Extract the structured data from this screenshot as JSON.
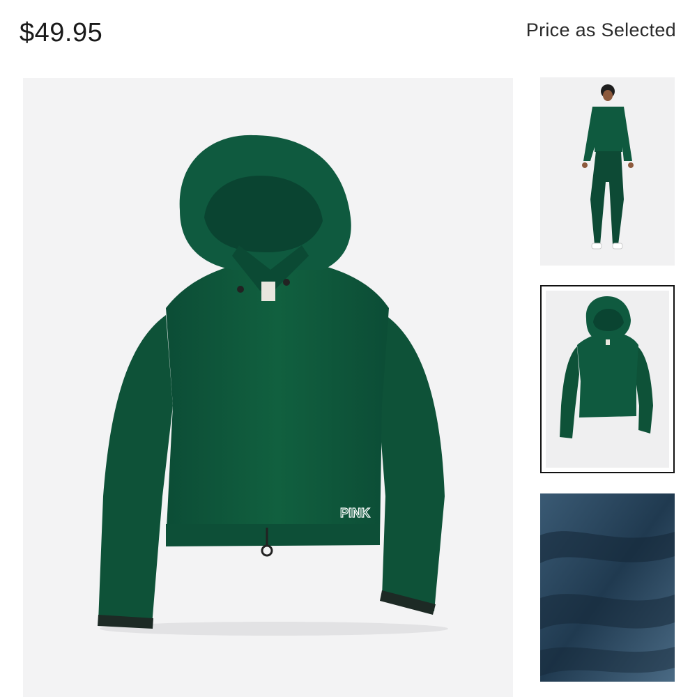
{
  "product": {
    "price": "$49.95",
    "price_note": "Price as Selected",
    "logo_text": "PINK",
    "color": "#0f5a3f"
  },
  "gallery": {
    "main_image": "green-cropped-hoodie-flatlay",
    "thumbnails": [
      {
        "name": "model-wearing-hoodie",
        "selected": false
      },
      {
        "name": "hoodie-flatlay",
        "selected": true
      },
      {
        "name": "fabric-texture-closeup",
        "selected": false
      }
    ]
  }
}
